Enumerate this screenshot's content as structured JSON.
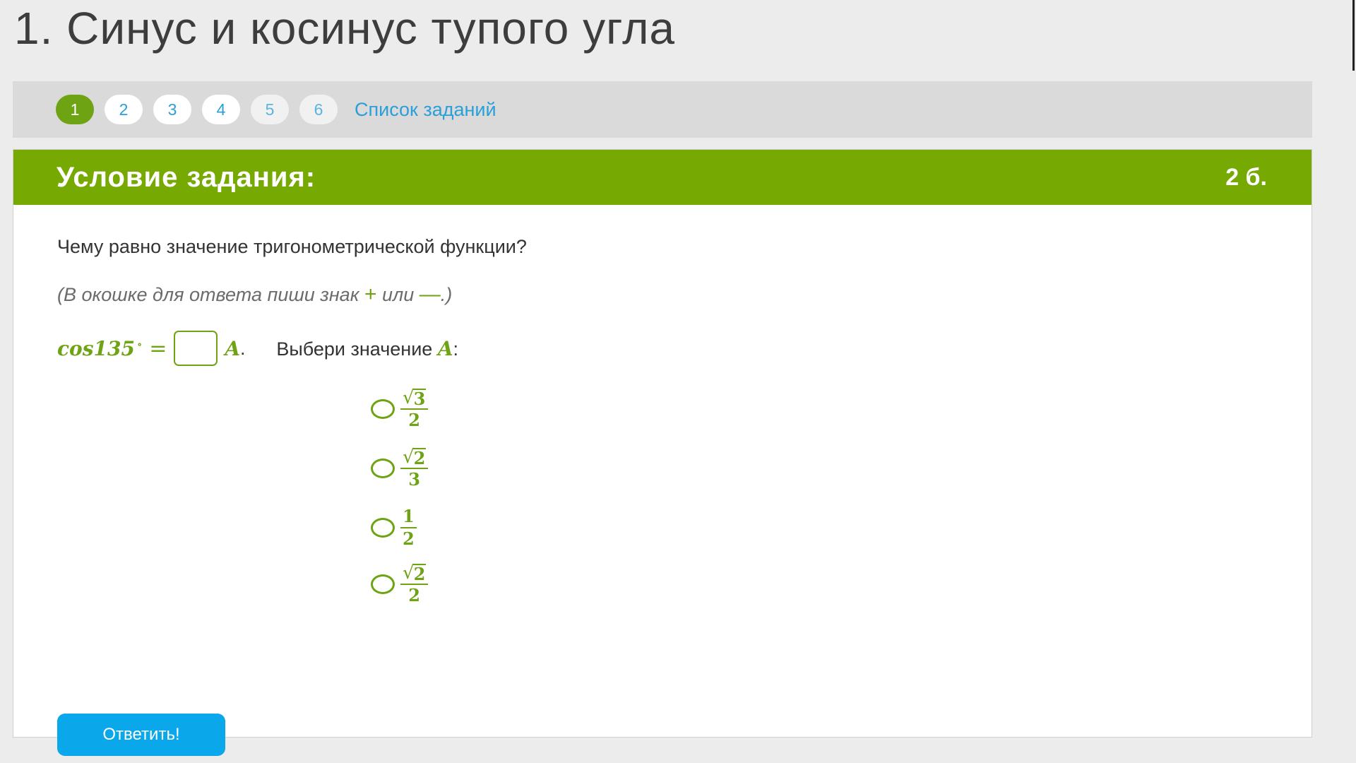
{
  "page": {
    "title": "1. Синус и косинус тупого угла"
  },
  "nav": {
    "steps": [
      "1",
      "2",
      "3",
      "4",
      "5",
      "6"
    ],
    "active_step": "1",
    "list_link": "Список заданий"
  },
  "task": {
    "header_title": "Условие задания:",
    "points": "2 б.",
    "question": "Чему равно значение тригонометрической функции?",
    "hint_before": "(В окошке для ответа пиши знак ",
    "hint_plus": "+",
    "hint_middle": " или ",
    "hint_minus": "—",
    "hint_after": ".)",
    "equation": {
      "function": "cos135",
      "degree": "∘",
      "equals": "=",
      "answer_value": "",
      "variable": "A",
      "period": "."
    },
    "choose_label_text": "Выбери значение ",
    "choose_label_var": "A",
    "choose_label_colon": ":",
    "options": [
      {
        "radical": "√",
        "numerator": "3",
        "denominator": "2",
        "has_sqrt": true
      },
      {
        "radical": "√",
        "numerator": "2",
        "denominator": "3",
        "has_sqrt": true
      },
      {
        "radical": "",
        "numerator": "1",
        "denominator": "2",
        "has_sqrt": false
      },
      {
        "radical": "√",
        "numerator": "2",
        "denominator": "2",
        "has_sqrt": true
      }
    ],
    "submit_label": "Ответить!"
  },
  "colors": {
    "accent_green": "#76aa02",
    "link_blue": "#2a9fd8",
    "button_blue": "#0aa8ea"
  }
}
